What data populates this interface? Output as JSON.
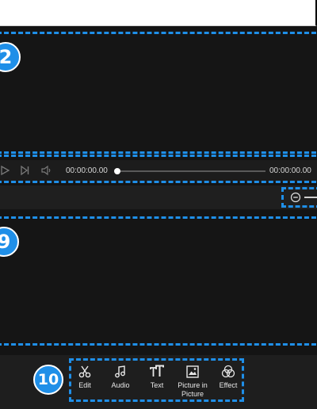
{
  "preview": {
    "badge": "2"
  },
  "playback": {
    "current_time": "00:00:00.00",
    "total_time": "00:00:00.00",
    "progress": 0
  },
  "timeline": {
    "badge": "9"
  },
  "toolbar": {
    "badge": "10",
    "items": [
      {
        "label": "Edit",
        "icon": "scissors-icon"
      },
      {
        "label": "Audio",
        "icon": "music-note-icon"
      },
      {
        "label": "Text",
        "icon": "text-icon"
      },
      {
        "label": "Picture in Picture",
        "icon": "picture-icon"
      },
      {
        "label": "Effect",
        "icon": "effect-icon"
      }
    ]
  },
  "colors": {
    "annotation": "#1f8fe8",
    "background": "#141414",
    "text": "#e8e8e8"
  }
}
